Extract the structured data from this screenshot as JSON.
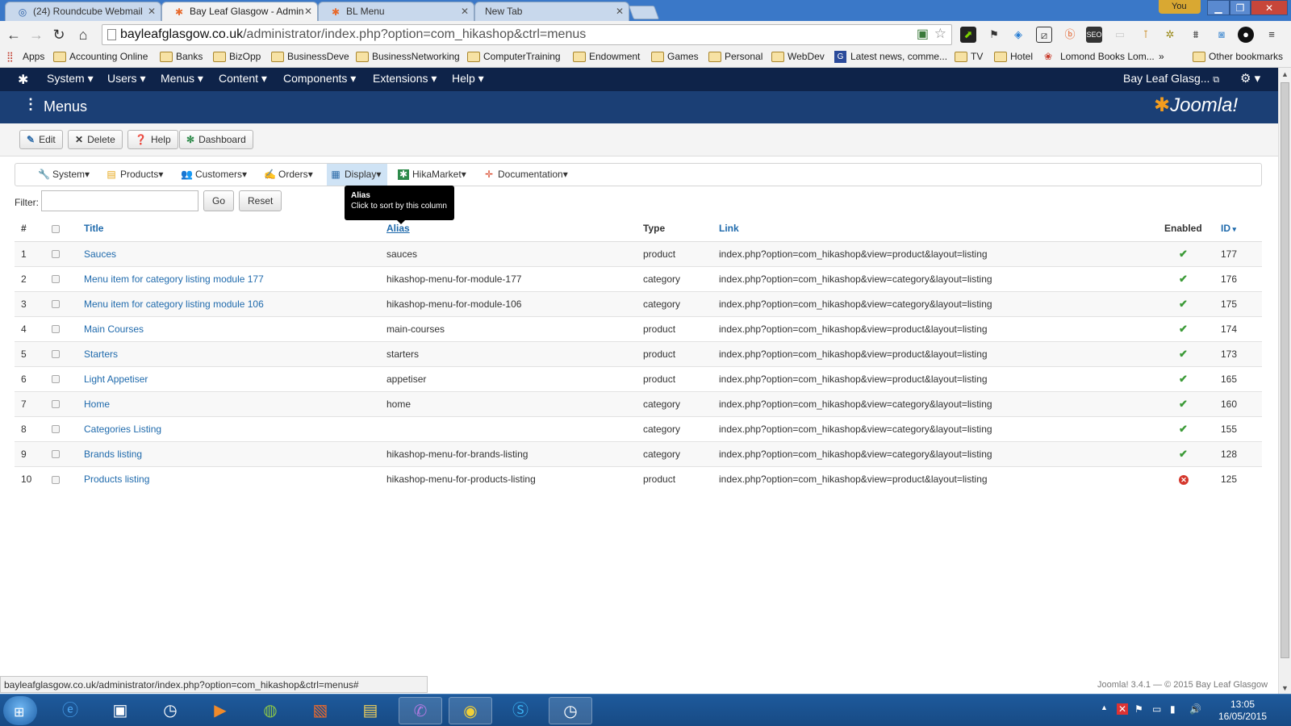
{
  "browser": {
    "tabs": [
      {
        "label": "(24) Roundcube Webmail",
        "icon": "roundcube-icon",
        "active": false
      },
      {
        "label": "Bay Leaf Glasgow - Admin",
        "icon": "joomla-icon",
        "active": true
      },
      {
        "label": "BL Menu",
        "icon": "joomla-icon",
        "active": false
      },
      {
        "label": "New Tab",
        "icon": "",
        "active": false
      }
    ],
    "profile": "You",
    "url_host": "bayleafglasgow.co.uk",
    "url_path": "/administrator/index.php?option=com_hikashop&ctrl=menus",
    "bookmarks": [
      "Apps",
      "Accounting Online",
      "Banks",
      "BizOpp",
      "BusinessDeve",
      "BusinessNetworking",
      "ComputerTraining",
      "Endowment",
      "Games",
      "Personal",
      "WebDev",
      "Latest news, comme...",
      "TV",
      "Hotel",
      "Lomond Books Lom...",
      "»",
      "Other bookmarks"
    ],
    "status_url": "bayleafglasgow.co.uk/administrator/index.php?option=com_hikashop&ctrl=menus#"
  },
  "joomla": {
    "topmenu": [
      "System",
      "Users",
      "Menus",
      "Content",
      "Components",
      "Extensions",
      "Help"
    ],
    "site_name": "Bay Leaf Glasg...",
    "page_title": "Menus",
    "brand": "Joomla!",
    "toolbar": {
      "edit": "Edit",
      "delete": "Delete",
      "help": "Help",
      "dashboard": "Dashboard"
    },
    "submenu": [
      "System",
      "Products",
      "Customers",
      "Orders",
      "Display",
      "HikaMarket",
      "Documentation"
    ],
    "filter_label": "Filter:",
    "filter_value": "",
    "go": "Go",
    "reset": "Reset",
    "tooltip": {
      "title": "Alias",
      "text": "Click to sort by this column"
    },
    "footer": "Joomla! 3.4.1  —  © 2015 Bay Leaf Glasgow"
  },
  "table": {
    "headers": {
      "num": "#",
      "title": "Title",
      "alias": "Alias",
      "type": "Type",
      "link": "Link",
      "enabled": "Enabled",
      "id": "ID"
    },
    "rows": [
      {
        "num": "1",
        "title": "Sauces",
        "alias": "sauces",
        "type": "product",
        "link": "index.php?option=com_hikashop&view=product&layout=listing",
        "enabled": true,
        "id": "177"
      },
      {
        "num": "2",
        "title": "Menu item for category listing module 177",
        "alias": "hikashop-menu-for-module-177",
        "type": "category",
        "link": "index.php?option=com_hikashop&view=category&layout=listing",
        "enabled": true,
        "id": "176"
      },
      {
        "num": "3",
        "title": "Menu item for category listing module 106",
        "alias": "hikashop-menu-for-module-106",
        "type": "category",
        "link": "index.php?option=com_hikashop&view=category&layout=listing",
        "enabled": true,
        "id": "175"
      },
      {
        "num": "4",
        "title": "Main Courses",
        "alias": "main-courses",
        "type": "product",
        "link": "index.php?option=com_hikashop&view=product&layout=listing",
        "enabled": true,
        "id": "174"
      },
      {
        "num": "5",
        "title": "Starters",
        "alias": "starters",
        "type": "product",
        "link": "index.php?option=com_hikashop&view=product&layout=listing",
        "enabled": true,
        "id": "173"
      },
      {
        "num": "6",
        "title": "Light Appetiser",
        "alias": "appetiser",
        "type": "product",
        "link": "index.php?option=com_hikashop&view=product&layout=listing",
        "enabled": true,
        "id": "165"
      },
      {
        "num": "7",
        "title": "Home",
        "alias": "home",
        "type": "category",
        "link": "index.php?option=com_hikashop&view=category&layout=listing",
        "enabled": true,
        "id": "160"
      },
      {
        "num": "8",
        "title": "Categories Listing",
        "alias": "",
        "type": "category",
        "link": "index.php?option=com_hikashop&view=category&layout=listing",
        "enabled": true,
        "id": "155"
      },
      {
        "num": "9",
        "title": "Brands listing",
        "alias": "hikashop-menu-for-brands-listing",
        "type": "category",
        "link": "index.php?option=com_hikashop&view=category&layout=listing",
        "enabled": true,
        "id": "128"
      },
      {
        "num": "10",
        "title": "Products listing",
        "alias": "hikashop-menu-for-products-listing",
        "type": "product",
        "link": "index.php?option=com_hikashop&view=product&layout=listing",
        "enabled": false,
        "id": "125"
      }
    ]
  },
  "taskbar": {
    "time": "13:05",
    "date": "16/05/2015"
  },
  "colors": {
    "joomla_nav": "#0e2349",
    "joomla_header": "#1b3f75",
    "link": "#1f6aac",
    "enabled": "#3b9a37",
    "disabled": "#d4362b"
  }
}
